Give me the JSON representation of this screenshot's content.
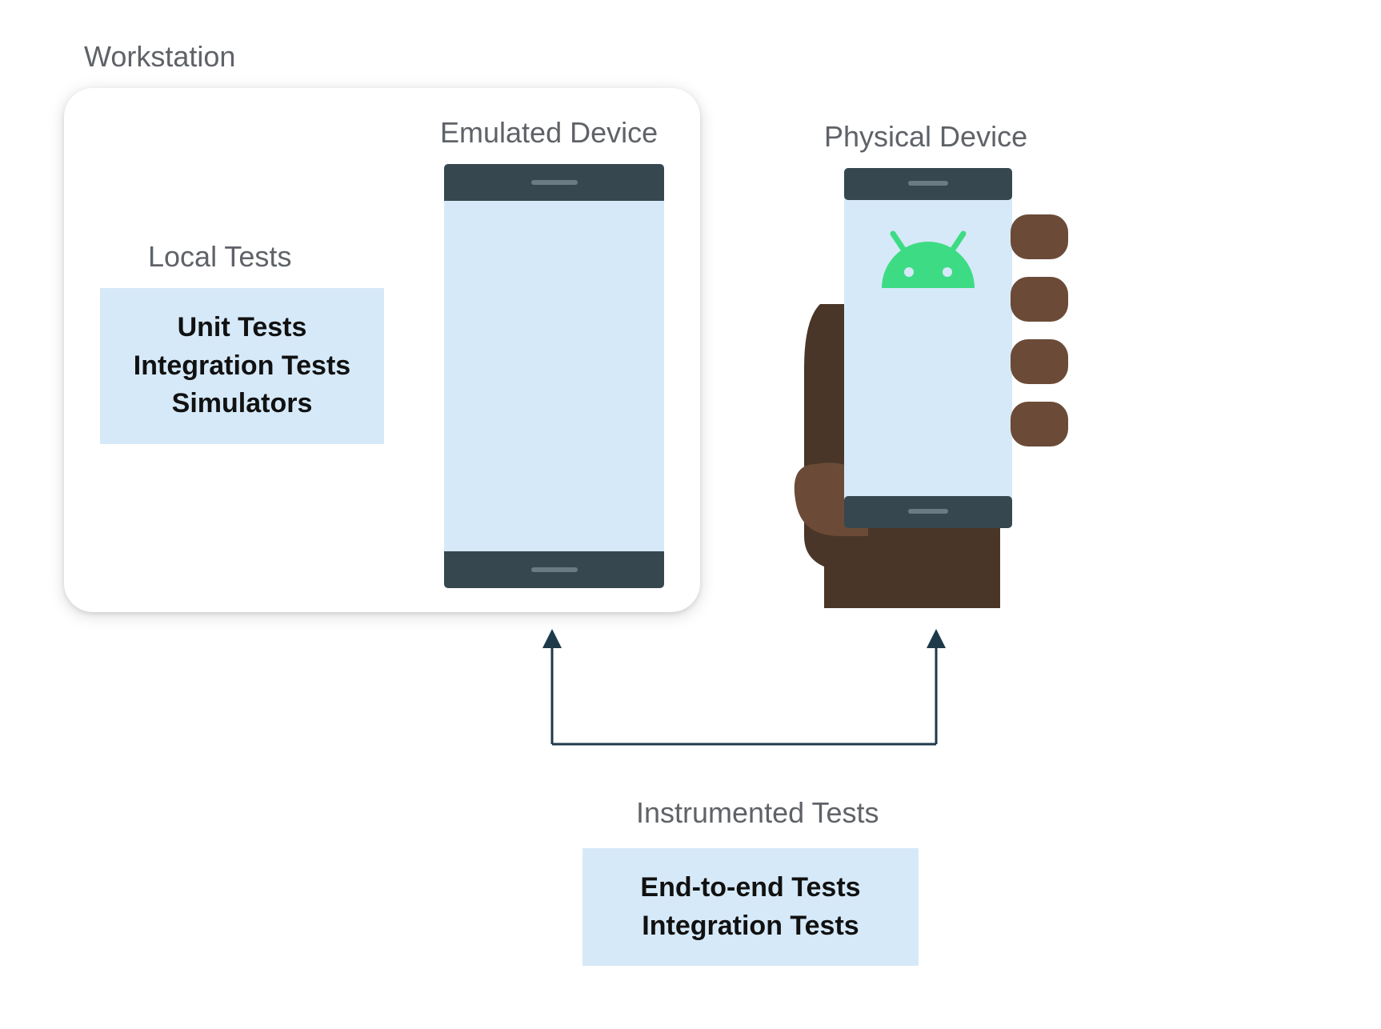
{
  "workstation": {
    "label": "Workstation"
  },
  "emulated": {
    "label": "Emulated Device"
  },
  "physical": {
    "label": "Physical Device"
  },
  "local_tests": {
    "heading": "Local Tests",
    "line1": "Unit Tests",
    "line2": "Integration Tests",
    "line3": "Simulators"
  },
  "instrumented": {
    "heading": "Instrumented Tests",
    "line1": "End-to-end Tests",
    "line2": "Integration Tests"
  }
}
